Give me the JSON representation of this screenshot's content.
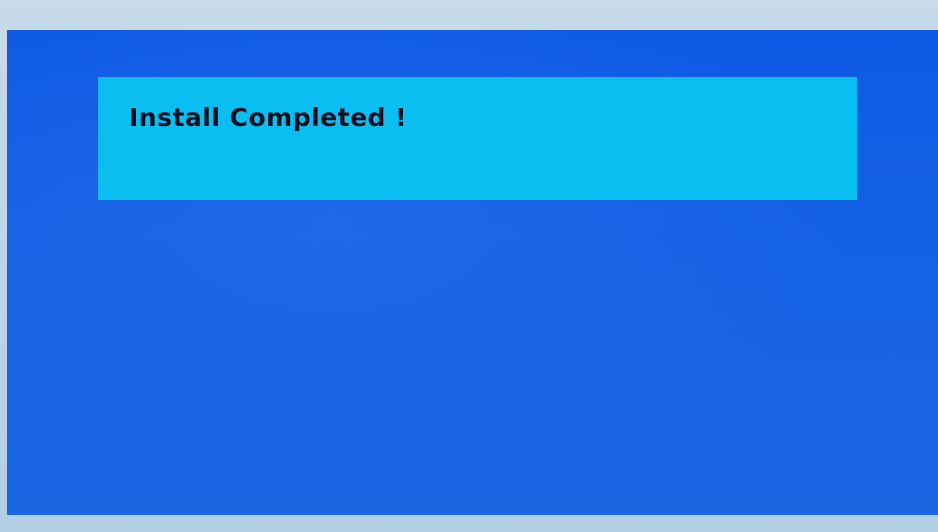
{
  "dialog": {
    "message": "Install Completed !"
  },
  "colors": {
    "screen_background": "#1561e4",
    "message_box": "#0bbef2",
    "message_text": "#0b1020",
    "bezel": "#b9d3e6"
  }
}
